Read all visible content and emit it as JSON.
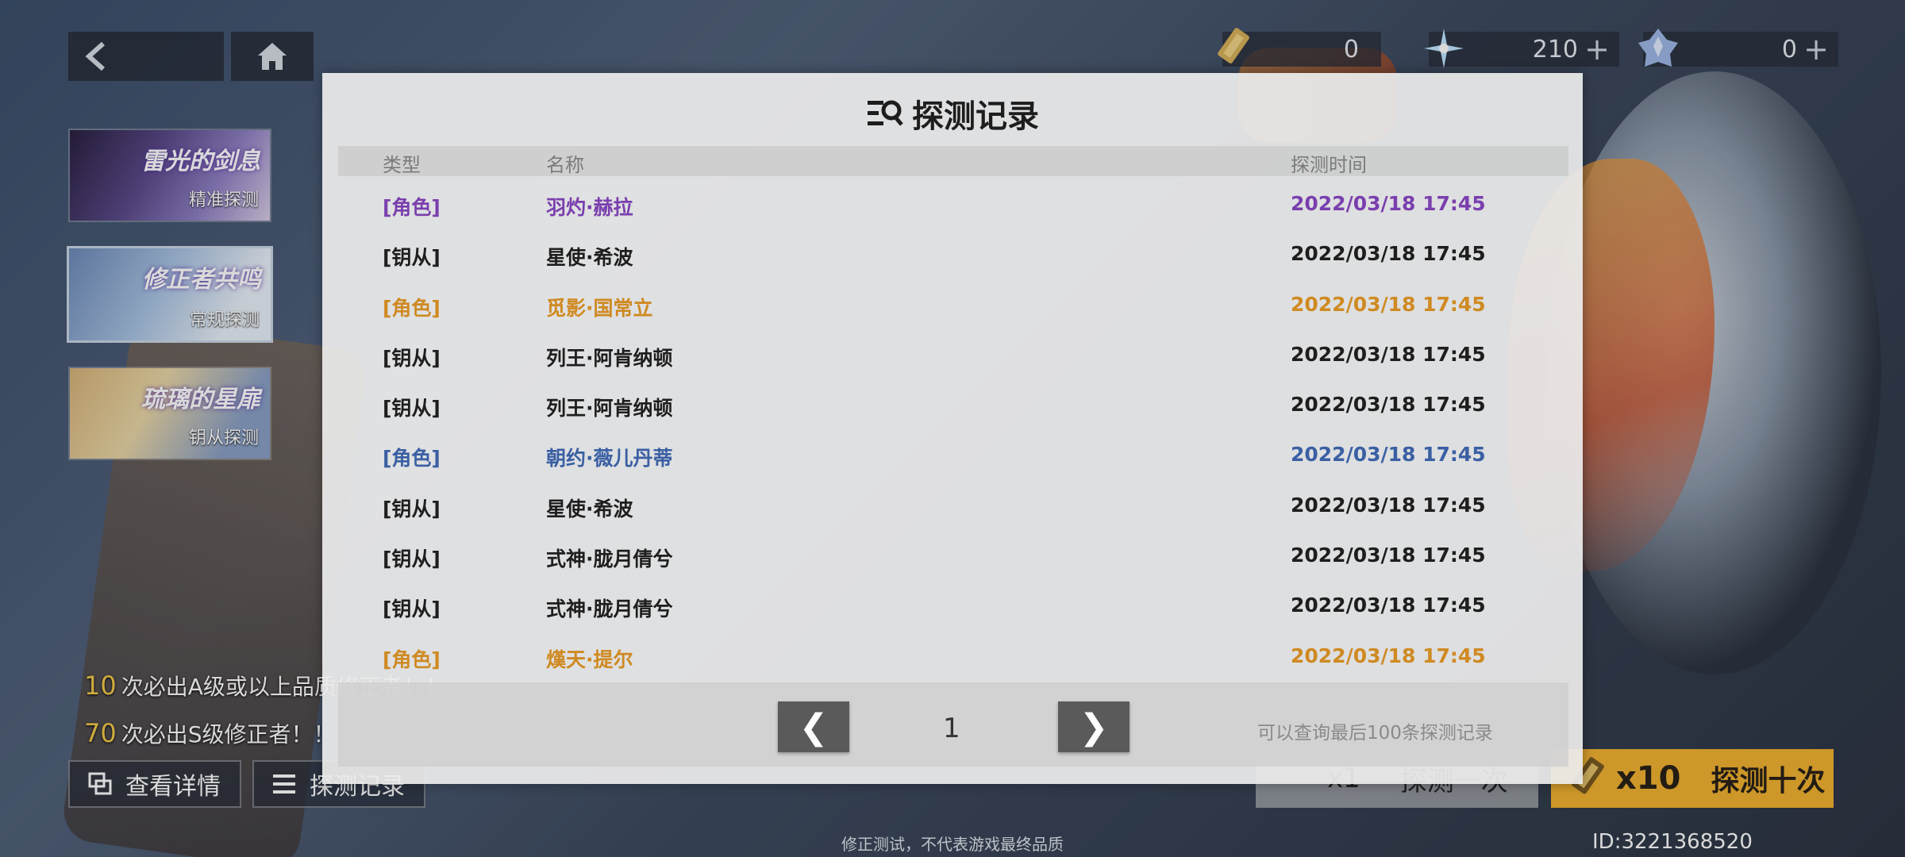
{
  "resources": [
    {
      "name": "ticket",
      "value": "0",
      "has_plus": false
    },
    {
      "name": "star-crystal",
      "value": "210",
      "has_plus": true
    },
    {
      "name": "ice-crystal",
      "value": "0",
      "has_plus": true
    }
  ],
  "banners": [
    {
      "title": "雷光的剑息",
      "subtitle": "精准探测"
    },
    {
      "title": "修正者共鸣",
      "subtitle": "常规探测"
    },
    {
      "title": "琉璃的星扉",
      "subtitle": "钥从探测"
    }
  ],
  "guarantee": [
    {
      "num": "10",
      "text": "次必出A级或以上品质修正者！！"
    },
    {
      "num": "70",
      "text": "次必出S级修正者！！"
    }
  ],
  "buttons": {
    "detail": "查看详情",
    "record": "探测记录",
    "pull_one_mult": "x1",
    "pull_one": "探测一次",
    "pull_ten_mult": "x10",
    "pull_ten": "探测十次"
  },
  "footer_note": "修正测试，不代表游戏最终品质",
  "uid": "ID:3221368520",
  "modal": {
    "title": "探测记录",
    "headers": {
      "type": "类型",
      "name": "名称",
      "time": "探测时间"
    },
    "rows": [
      {
        "type": "[角色]",
        "name": "羽灼·赫拉",
        "time": "2022/03/18 17:45",
        "color": "#7a3fae"
      },
      {
        "type": "[钥从]",
        "name": "星使·希波",
        "time": "2022/03/18 17:45",
        "color": "#1e1e1e"
      },
      {
        "type": "[角色]",
        "name": "觅影·国常立",
        "time": "2022/03/18 17:45",
        "color": "#cf8a22"
      },
      {
        "type": "[钥从]",
        "name": "列王·阿肯纳顿",
        "time": "2022/03/18 17:45",
        "color": "#1e1e1e"
      },
      {
        "type": "[钥从]",
        "name": "列王·阿肯纳顿",
        "time": "2022/03/18 17:45",
        "color": "#1e1e1e"
      },
      {
        "type": "[角色]",
        "name": "朝约·薇儿丹蒂",
        "time": "2022/03/18 17:45",
        "color": "#3a5fa3"
      },
      {
        "type": "[钥从]",
        "name": "星使·希波",
        "time": "2022/03/18 17:45",
        "color": "#1e1e1e"
      },
      {
        "type": "[钥从]",
        "name": "式神·胧月倩兮",
        "time": "2022/03/18 17:45",
        "color": "#1e1e1e"
      },
      {
        "type": "[钥从]",
        "name": "式神·胧月倩兮",
        "time": "2022/03/18 17:45",
        "color": "#1e1e1e"
      },
      {
        "type": "[角色]",
        "name": "熯天·提尔",
        "time": "2022/03/18 17:45",
        "color": "#cf8a22"
      }
    ],
    "pager": {
      "page": "1",
      "note": "可以查询最后100条探测记录"
    }
  }
}
